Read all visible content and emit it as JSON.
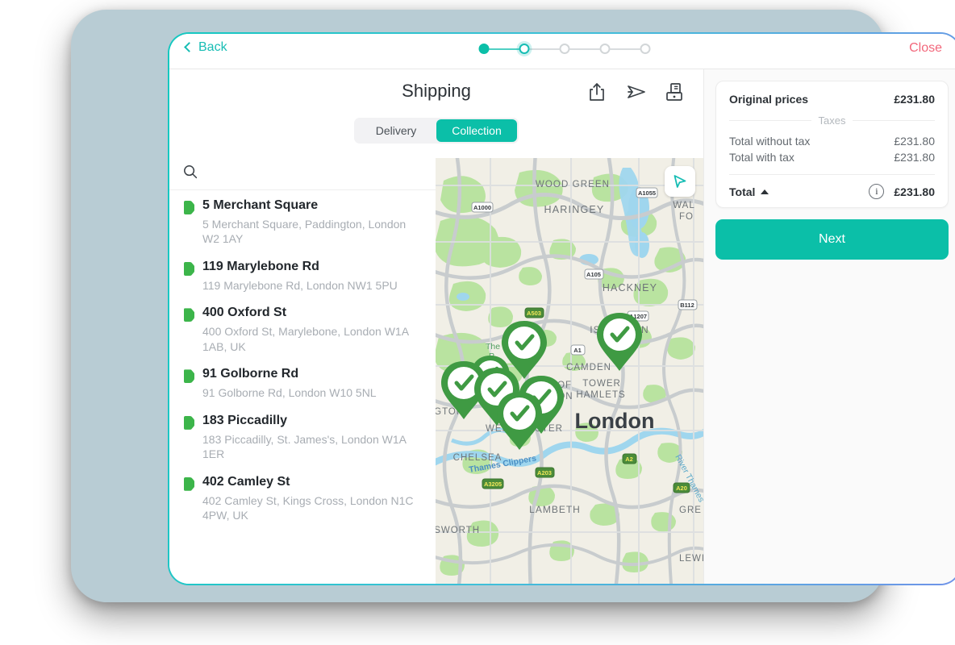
{
  "topbar": {
    "back_label": "Back",
    "close_label": "Close",
    "steps": [
      {
        "state": "done"
      },
      {
        "state": "current"
      },
      {
        "state": "pending"
      },
      {
        "state": "pending"
      },
      {
        "state": "pending"
      }
    ]
  },
  "header": {
    "title": "Shipping",
    "icons": [
      {
        "name": "share-icon"
      },
      {
        "name": "send-icon"
      },
      {
        "name": "cash-register-icon"
      }
    ]
  },
  "segmented": {
    "options": [
      {
        "label": "Delivery",
        "active": false
      },
      {
        "label": "Collection",
        "active": true
      }
    ]
  },
  "search": {
    "value": "",
    "placeholder": ""
  },
  "addresses": [
    {
      "title": "5 Merchant Square",
      "subtitle": "5 Merchant Square, Paddington, London W2 1AY"
    },
    {
      "title": "119 Marylebone Rd",
      "subtitle": "119 Marylebone Rd, London NW1 5PU"
    },
    {
      "title": "400 Oxford St",
      "subtitle": "400 Oxford St, Marylebone, London W1A 1AB, UK"
    },
    {
      "title": "91 Golborne Rd",
      "subtitle": "91 Golborne Rd, London W10 5NL"
    },
    {
      "title": "183 Piccadilly",
      "subtitle": "183 Piccadilly, St. James's, London W1A 1ER"
    },
    {
      "title": "402 Camley St",
      "subtitle": "402 Camley St, Kings Cross, London N1C 4PW, UK"
    }
  ],
  "map": {
    "locate_icon": "navigation-arrow-icon",
    "city_label": "London",
    "area_labels": [
      "WOOD GREEN",
      "HARINGEY",
      "HACKNEY",
      "ISLINGTON",
      "CAMDEN",
      "TOWER HAMLETS",
      "CITY OF LONDON",
      "CITY OF WESTMINSTER",
      "CHELSEA",
      "LAMBETH",
      "KENSINGTON",
      "WANDSWORTH",
      "WALTHAM FOREST",
      "GREENWICH",
      "LEWISHAM"
    ],
    "water_labels": [
      "River Thames",
      "Thames Clippers",
      "The Regent's P"
    ],
    "road_badges": [
      "A1000",
      "A1055",
      "A105",
      "A503",
      "A1207",
      "B112",
      "A1",
      "A2",
      "A20",
      "A203",
      "A3205"
    ],
    "pin_count": 7
  },
  "summary": {
    "original_prices_label": "Original prices",
    "original_prices_value": "£231.80",
    "taxes_label": "Taxes",
    "total_without_tax_label": "Total without tax",
    "total_without_tax_value": "£231.80",
    "total_with_tax_label": "Total with tax",
    "total_with_tax_value": "£231.80",
    "total_label": "Total",
    "total_value": "£231.80",
    "info_glyph": "i"
  },
  "next_button": {
    "label": "Next"
  },
  "colors": {
    "accent_teal": "#0bbfa8",
    "link_teal": "#17bdb4",
    "close_red": "#f2677b",
    "pin_green": "#3cb54a",
    "frame": "#b8ccd4"
  }
}
